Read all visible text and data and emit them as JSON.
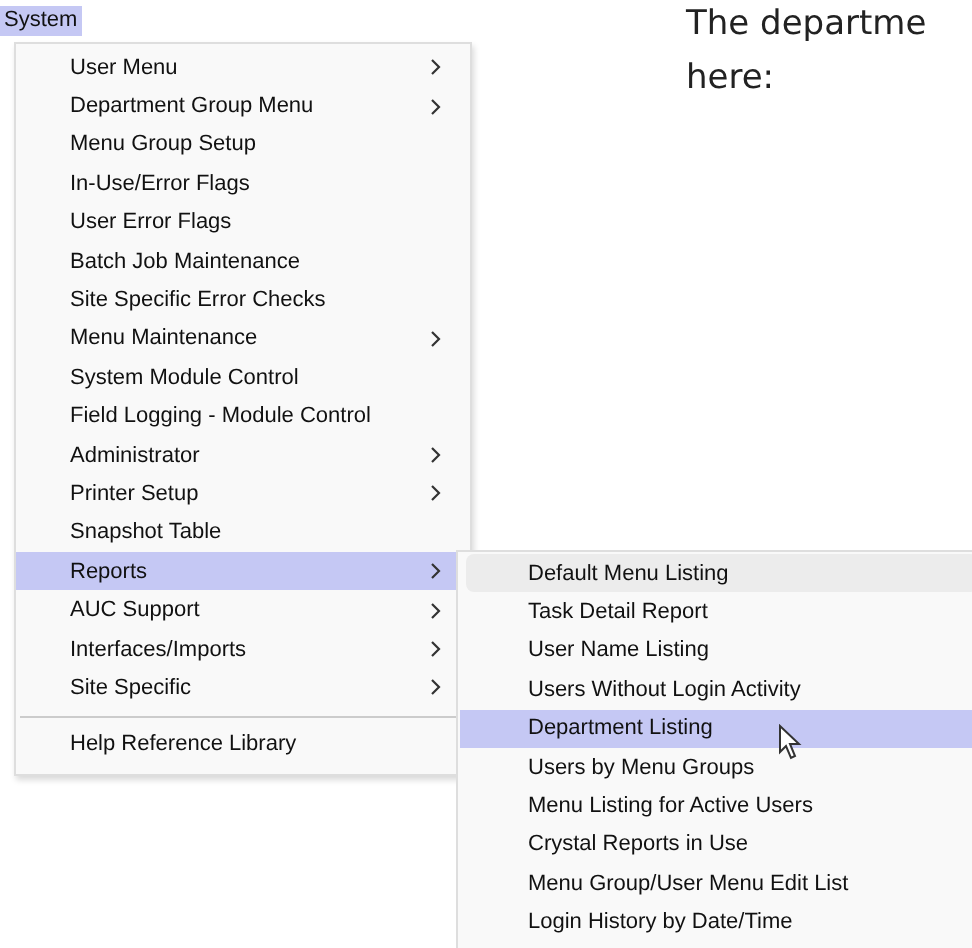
{
  "document": {
    "lines": [
      "The departme",
      "here:"
    ]
  },
  "menu_bar": [
    {
      "label": "System",
      "selected": true
    }
  ],
  "menu": {
    "items": [
      {
        "kind": "item",
        "label": "User Menu",
        "submenu": true,
        "selected": false
      },
      {
        "kind": "item",
        "label": "Department Group Menu",
        "submenu": true,
        "selected": false
      },
      {
        "kind": "item",
        "label": "Menu Group Setup",
        "submenu": false,
        "selected": false
      },
      {
        "kind": "item",
        "label": "In-Use/Error Flags",
        "submenu": false,
        "selected": false
      },
      {
        "kind": "item",
        "label": "User Error Flags",
        "submenu": false,
        "selected": false
      },
      {
        "kind": "item",
        "label": "Batch Job Maintenance",
        "submenu": false,
        "selected": false
      },
      {
        "kind": "item",
        "label": "Site Specific Error Checks",
        "submenu": false,
        "selected": false
      },
      {
        "kind": "item",
        "label": "Menu Maintenance",
        "submenu": true,
        "selected": false
      },
      {
        "kind": "item",
        "label": "System Module Control",
        "submenu": false,
        "selected": false
      },
      {
        "kind": "item",
        "label": "Field Logging - Module Control",
        "submenu": false,
        "selected": false
      },
      {
        "kind": "item",
        "label": "Administrator",
        "submenu": true,
        "selected": false
      },
      {
        "kind": "item",
        "label": "Printer Setup",
        "submenu": true,
        "selected": false
      },
      {
        "kind": "item",
        "label": "Snapshot Table",
        "submenu": false,
        "selected": false
      },
      {
        "kind": "item",
        "label": "Reports",
        "submenu": true,
        "selected": true
      },
      {
        "kind": "item",
        "label": "AUC Support",
        "submenu": true,
        "selected": false
      },
      {
        "kind": "item",
        "label": "Interfaces/Imports",
        "submenu": true,
        "selected": false
      },
      {
        "kind": "item",
        "label": "Site Specific",
        "submenu": true,
        "selected": false
      },
      {
        "kind": "separator"
      },
      {
        "kind": "item",
        "label": "Help Reference Library",
        "submenu": false,
        "selected": false
      }
    ]
  },
  "submenu": {
    "items": [
      {
        "label": "Default Menu Listing",
        "hovered": true,
        "selected": false
      },
      {
        "label": "Task Detail Report",
        "hovered": false,
        "selected": false
      },
      {
        "label": "User Name Listing",
        "hovered": false,
        "selected": false
      },
      {
        "label": "Users Without Login Activity",
        "hovered": false,
        "selected": false
      },
      {
        "label": "Department Listing",
        "hovered": false,
        "selected": true
      },
      {
        "label": "Users by Menu Groups",
        "hovered": false,
        "selected": false
      },
      {
        "label": "Menu Listing for Active Users",
        "hovered": false,
        "selected": false
      },
      {
        "label": "Crystal Reports in Use",
        "hovered": false,
        "selected": false
      },
      {
        "label": "Menu Group/User Menu Edit List",
        "hovered": false,
        "selected": false
      },
      {
        "label": "Login History by Date/Time",
        "hovered": false,
        "selected": false
      }
    ]
  }
}
